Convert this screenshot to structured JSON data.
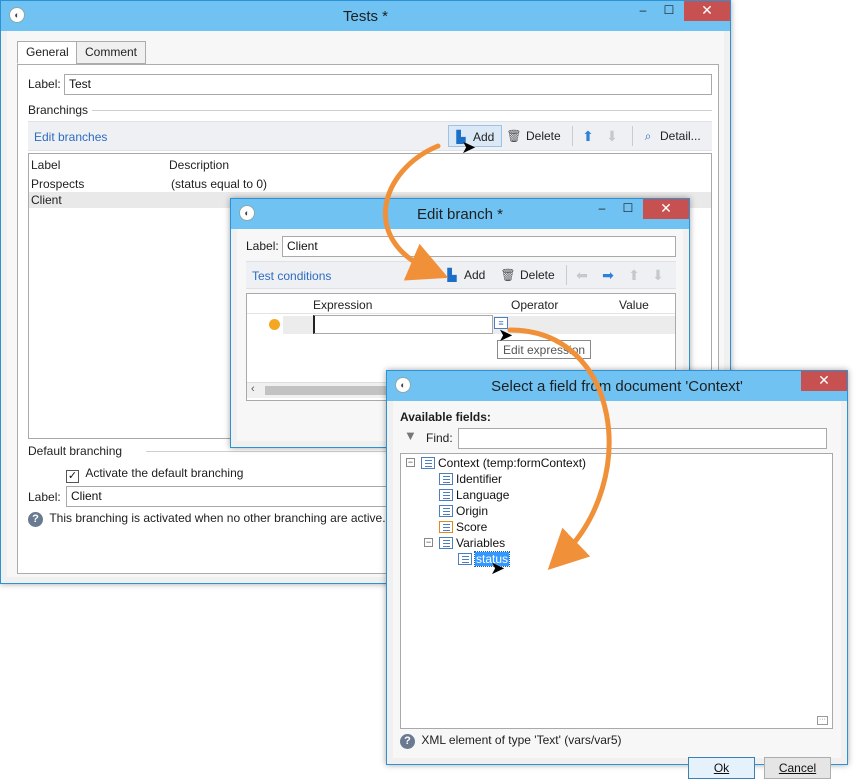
{
  "tests_window": {
    "title": "Tests *",
    "tabs": [
      "General",
      "Comment"
    ],
    "label_caption": "Label:",
    "label_value": "Test",
    "branchings_caption": "Branchings",
    "edit_branches": "Edit branches",
    "toolbar": {
      "add": "Add",
      "delete": "Delete",
      "detail": "Detail..."
    },
    "columns": [
      "Label",
      "Description"
    ],
    "rows": [
      {
        "label": "Prospects",
        "description": "(status equal to 0)"
      },
      {
        "label": "Client",
        "description": ""
      }
    ],
    "default_branching_caption": "Default branching",
    "activate_default": "Activate the default branching",
    "default_label_caption": "Label:",
    "default_label_value": "Client",
    "help_text": "This branching is activated when no other branching are active."
  },
  "edit_branch_window": {
    "title": "Edit branch *",
    "label_caption": "Label:",
    "label_value": "Client",
    "test_conditions": "Test conditions",
    "toolbar": {
      "add": "Add",
      "delete": "Delete"
    },
    "columns": [
      "Expression",
      "Operator",
      "Value"
    ],
    "tooltip": "Edit expression"
  },
  "select_field_window": {
    "title": "Select a field from document 'Context'",
    "available_fields": "Available fields:",
    "find_caption": "Find:",
    "find_value": "",
    "tree": {
      "root": "Context (temp:formContext)",
      "children": [
        "Identifier",
        "Language",
        "Origin",
        "Score"
      ],
      "variables": "Variables",
      "variable_children": [
        "status"
      ]
    },
    "help_text": "XML element of type 'Text' (vars/var5)",
    "ok": "Ok",
    "cancel": "Cancel"
  },
  "colors": {
    "titlebar": "#6fc2f2",
    "accent": "#2d6cc0",
    "arrow": "#f0913a",
    "close": "#c75050"
  }
}
